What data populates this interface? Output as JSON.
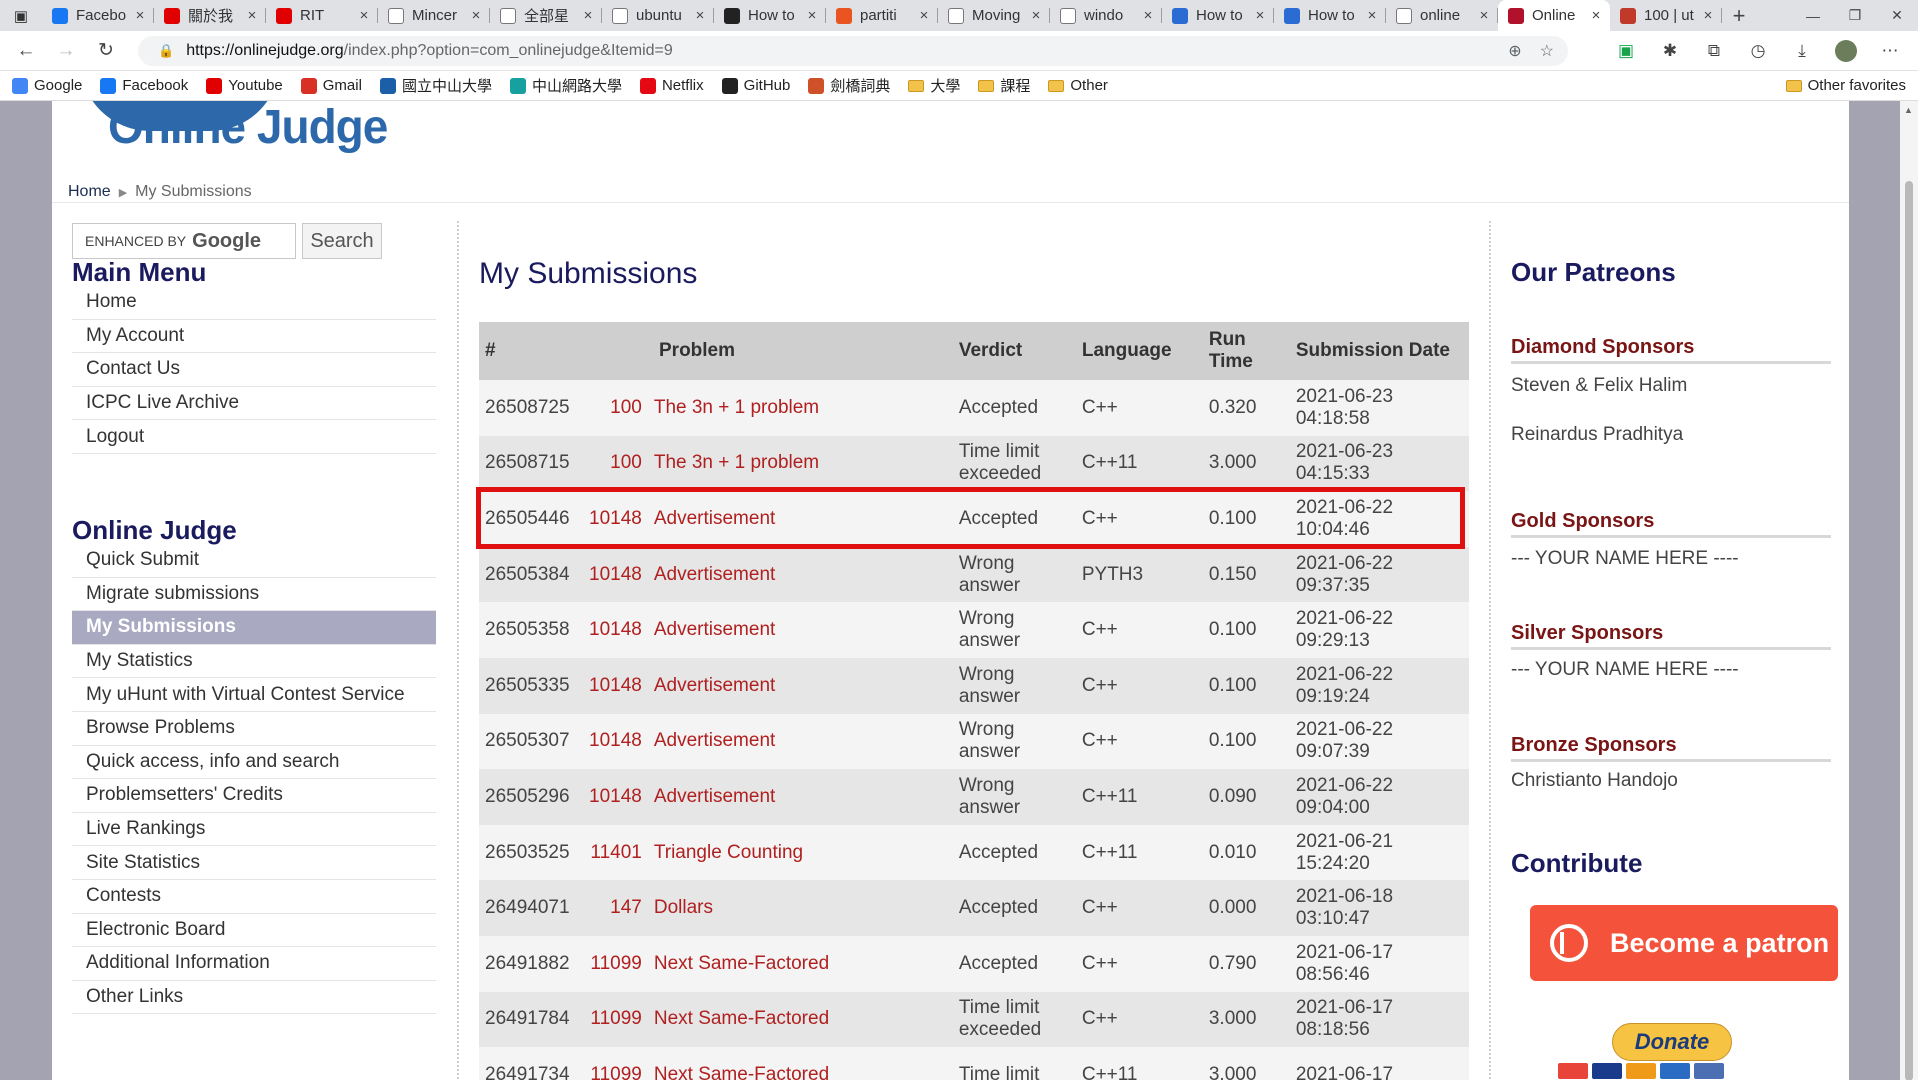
{
  "browser": {
    "tabs": [
      {
        "title": "Facebo",
        "favicon": "facebook-icon",
        "color": "#1877f2",
        "active": false
      },
      {
        "title": "關於我",
        "favicon": "youtube-icon",
        "color": "#e00000",
        "active": false
      },
      {
        "title": "RIT",
        "favicon": "youtube-icon",
        "color": "#e00000",
        "active": false
      },
      {
        "title": "Mincer",
        "favicon": "document-icon",
        "color": "#ffffff",
        "active": false
      },
      {
        "title": "全部星",
        "favicon": "document-icon",
        "color": "#ffffff",
        "active": false
      },
      {
        "title": "ubuntu",
        "favicon": "google-icon",
        "color": "#ffffff",
        "active": false
      },
      {
        "title": "How to",
        "favicon": "htg-icon",
        "color": "#222222",
        "active": false
      },
      {
        "title": "partiti",
        "favicon": "askubuntu-icon",
        "color": "#e95420",
        "active": false
      },
      {
        "title": "Moving",
        "favicon": "medium-icon",
        "color": "#ffffff",
        "active": false
      },
      {
        "title": "windo",
        "favicon": "google-icon",
        "color": "#ffffff",
        "active": false
      },
      {
        "title": "How to",
        "favicon": "msdocs-icon",
        "color": "#2b6cd4",
        "active": false
      },
      {
        "title": "How to",
        "favicon": "msdocs-icon",
        "color": "#2b6cd4",
        "active": false
      },
      {
        "title": "online",
        "favicon": "google-icon",
        "color": "#ffffff",
        "active": false
      },
      {
        "title": "Online",
        "favicon": "uva-icon",
        "color": "#b0122b",
        "active": true
      },
      {
        "title": "100 | ut",
        "favicon": "qa-icon",
        "color": "#c0392b",
        "active": false
      }
    ],
    "close_glyph": "×",
    "new_tab_glyph": "+",
    "url_host": "https://onlinejudge.org",
    "url_path": "/index.php?option=com_onlinejudge&Itemid=9",
    "bookmarks": [
      {
        "label": "Google",
        "icon": "google-icon"
      },
      {
        "label": "Facebook",
        "icon": "facebook-icon"
      },
      {
        "label": "Youtube",
        "icon": "youtube-icon"
      },
      {
        "label": "Gmail",
        "icon": "gmail-icon"
      },
      {
        "label": "國立中山大學",
        "icon": "nsysu-icon"
      },
      {
        "label": "中山網路大學",
        "icon": "m-icon"
      },
      {
        "label": "Netflix",
        "icon": "netflix-icon"
      },
      {
        "label": "GitHub",
        "icon": "github-icon"
      },
      {
        "label": "劍橋詞典",
        "icon": "cambridge-icon"
      },
      {
        "label": "大學",
        "icon": "folder-icon"
      },
      {
        "label": "課程",
        "icon": "folder-icon"
      },
      {
        "label": "Other",
        "icon": "folder-icon"
      }
    ],
    "other_favorites": "Other favorites"
  },
  "page": {
    "breadcrumb": {
      "home": "Home",
      "current": "My Submissions"
    },
    "logo_text": "Online Judge",
    "search": {
      "brand_prefix": "ENHANCED BY",
      "brand": "Google",
      "button": "Search"
    },
    "main_menu": {
      "title": "Main Menu",
      "items": [
        "Home",
        "My Account",
        "Contact Us",
        "ICPC Live Archive",
        "Logout"
      ]
    },
    "online_judge_menu": {
      "title": "Online Judge",
      "items": [
        "Quick Submit",
        "Migrate submissions",
        "My Submissions",
        "My Statistics",
        "My uHunt with Virtual Contest Service",
        "Browse Problems",
        "Quick access, info and search",
        "Problemsetters' Credits",
        "Live Rankings",
        "Site Statistics",
        "Contests",
        "Electronic Board",
        "Additional Information",
        "Other Links"
      ],
      "selected": "My Submissions"
    },
    "main_title": "My Submissions",
    "table": {
      "headers": [
        "#",
        "Problem",
        "Verdict",
        "Language",
        "Run Time",
        "Submission Date"
      ],
      "rows": [
        {
          "id": "26508725",
          "num": "100",
          "name": "The 3n + 1 problem",
          "verdict": "Accepted",
          "lang": "C++",
          "time": "0.320",
          "date": "2021-06-23 04:18:58"
        },
        {
          "id": "26508715",
          "num": "100",
          "name": "The 3n + 1 problem",
          "verdict": "Time limit exceeded",
          "lang": "C++11",
          "time": "3.000",
          "date": "2021-06-23 04:15:33"
        },
        {
          "id": "26505446",
          "num": "10148",
          "name": "Advertisement",
          "verdict": "Accepted",
          "lang": "C++",
          "time": "0.100",
          "date": "2021-06-22 10:04:46"
        },
        {
          "id": "26505384",
          "num": "10148",
          "name": "Advertisement",
          "verdict": "Wrong answer",
          "lang": "PYTH3",
          "time": "0.150",
          "date": "2021-06-22 09:37:35"
        },
        {
          "id": "26505358",
          "num": "10148",
          "name": "Advertisement",
          "verdict": "Wrong answer",
          "lang": "C++",
          "time": "0.100",
          "date": "2021-06-22 09:29:13"
        },
        {
          "id": "26505335",
          "num": "10148",
          "name": "Advertisement",
          "verdict": "Wrong answer",
          "lang": "C++",
          "time": "0.100",
          "date": "2021-06-22 09:19:24"
        },
        {
          "id": "26505307",
          "num": "10148",
          "name": "Advertisement",
          "verdict": "Wrong answer",
          "lang": "C++",
          "time": "0.100",
          "date": "2021-06-22 09:07:39"
        },
        {
          "id": "26505296",
          "num": "10148",
          "name": "Advertisement",
          "verdict": "Wrong answer",
          "lang": "C++11",
          "time": "0.090",
          "date": "2021-06-22 09:04:00"
        },
        {
          "id": "26503525",
          "num": "11401",
          "name": "Triangle Counting",
          "verdict": "Accepted",
          "lang": "C++11",
          "time": "0.010",
          "date": "2021-06-21 15:24:20"
        },
        {
          "id": "26494071",
          "num": "147",
          "name": "Dollars",
          "verdict": "Accepted",
          "lang": "C++",
          "time": "0.000",
          "date": "2021-06-18 03:10:47"
        },
        {
          "id": "26491882",
          "num": "11099",
          "name": "Next Same-Factored",
          "verdict": "Accepted",
          "lang": "C++",
          "time": "0.790",
          "date": "2021-06-17 08:56:46"
        },
        {
          "id": "26491784",
          "num": "11099",
          "name": "Next Same-Factored",
          "verdict": "Time limit exceeded",
          "lang": "C++",
          "time": "3.000",
          "date": "2021-06-17 08:18:56"
        },
        {
          "id": "26491734",
          "num": "11099",
          "name": "Next Same-Factored",
          "verdict": "Time limit",
          "lang": "C++11",
          "time": "3.000",
          "date": "2021-06-17"
        }
      ],
      "highlighted_row": "26505446",
      "highlight_color": "#e01010"
    },
    "right": {
      "patreons_title": "Our Patreons",
      "diamond_head": "Diamond Sponsors",
      "diamond_names": [
        "Steven & Felix Halim",
        "Reinardus Pradhitya"
      ],
      "gold_head": "Gold Sponsors",
      "gold_names": [
        "--- YOUR NAME HERE ----"
      ],
      "silver_head": "Silver Sponsors",
      "silver_names": [
        "--- YOUR NAME HERE ----"
      ],
      "bronze_head": "Bronze Sponsors",
      "bronze_names": [
        "Christianto Handojo"
      ],
      "contribute_title": "Contribute",
      "patron_button": "Become a patron",
      "donate_button": "Donate"
    }
  }
}
